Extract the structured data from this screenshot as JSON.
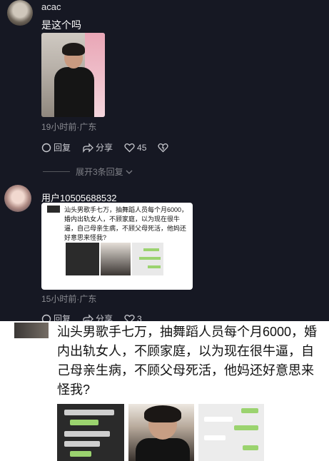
{
  "comment1": {
    "username": "acac",
    "text": "是这个吗",
    "meta": "19小时前·广东",
    "reply": "回复",
    "share": "分享",
    "likes": "45"
  },
  "expand": "展开3条回复",
  "comment2": {
    "username": "用户10505688532",
    "card_text": "汕头男歌手七万，抽舞蹈人员每个月6000，婚内出轨女人，不顾家庭，以为现在很牛逼，自己母亲生病，不顾父母死活，他妈还好意思来怪我?",
    "meta": "15小时前·广东",
    "reply": "回复",
    "share": "分享",
    "likes": "3"
  },
  "bottom": {
    "text": "汕头男歌手七万，抽舞蹈人员每个月6000，婚内出轨女人，不顾家庭，以为现在很牛逼，自己母亲生病，不顾父母死活，他妈还好意思来怪我?"
  },
  "icons": [
    "reply-icon",
    "share-icon",
    "heart-icon",
    "dislike-icon",
    "chevron-down-icon"
  ]
}
